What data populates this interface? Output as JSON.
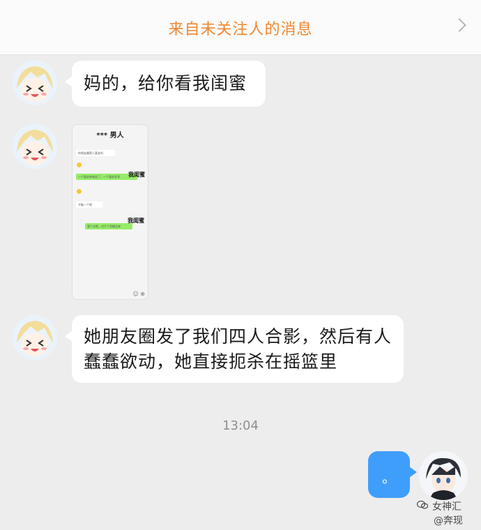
{
  "header": {
    "title": "来自未关注人的消息",
    "chevron_icon": "chevron-right-icon"
  },
  "messages": [
    {
      "sender": "other",
      "type": "text",
      "text": "妈的，给你看我闺蜜"
    },
    {
      "sender": "other",
      "type": "image",
      "screenshot": {
        "title": "*** 男人",
        "messages": [
          "你朋友圈是人真女吗",
          "一个喜欢单调说了，一个喜欢发骂",
          "才能一个吧",
          "我个诊断，对于个用精品单"
        ],
        "stickers": [
          "我闺蜜",
          "我闺蜜"
        ]
      }
    },
    {
      "sender": "other",
      "type": "text",
      "text": "她朋友圈发了我们四人合影，然后有人蠢蠢欲动，她直接扼杀在摇篮里"
    }
  ],
  "timestamp": "13:04",
  "my_message": {
    "text": "。"
  },
  "watermark": {
    "line1": "女神汇",
    "line2": "@奔现"
  },
  "colors": {
    "header_title": "#f0862f",
    "bubble_blue": "#3f9efb",
    "background": "#ededed"
  }
}
